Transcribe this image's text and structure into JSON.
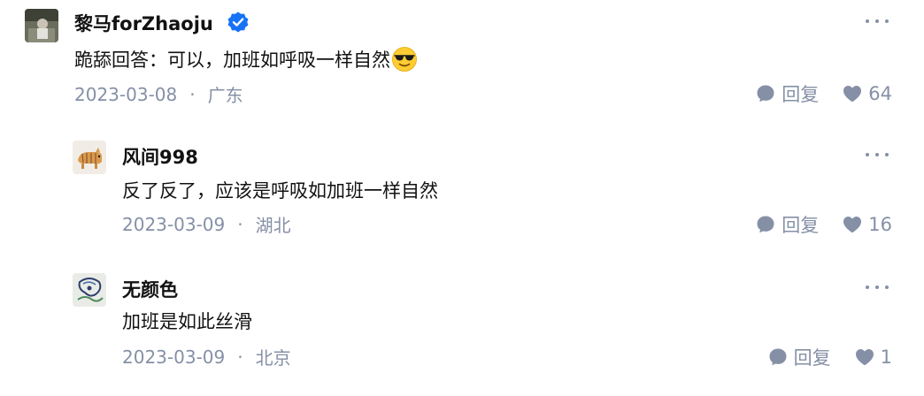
{
  "comments": [
    {
      "author": "黎马forZhaoju",
      "verified": true,
      "content": "跪舔回答：可以，加班如呼吸一样自然",
      "emoji": "sunglasses-emoji",
      "date": "2023-03-08",
      "location": "广东",
      "reply_label": "回复",
      "likes": "64"
    },
    {
      "author": "风间998",
      "content": "反了反了，应该是呼吸如加班一样自然",
      "date": "2023-03-09",
      "location": "湖北",
      "reply_label": "回复",
      "likes": "16"
    },
    {
      "author": "无颜色",
      "content": "加班是如此丝滑",
      "date": "2023-03-09",
      "location": "北京",
      "reply_label": "回复",
      "likes": "1"
    }
  ],
  "meta_separator": "·",
  "colors": {
    "text": "#121212",
    "muted": "#8590a6",
    "verified": "#1772f6"
  },
  "icons": [
    "more-icon",
    "verified-icon",
    "comment-icon",
    "heart-icon"
  ]
}
